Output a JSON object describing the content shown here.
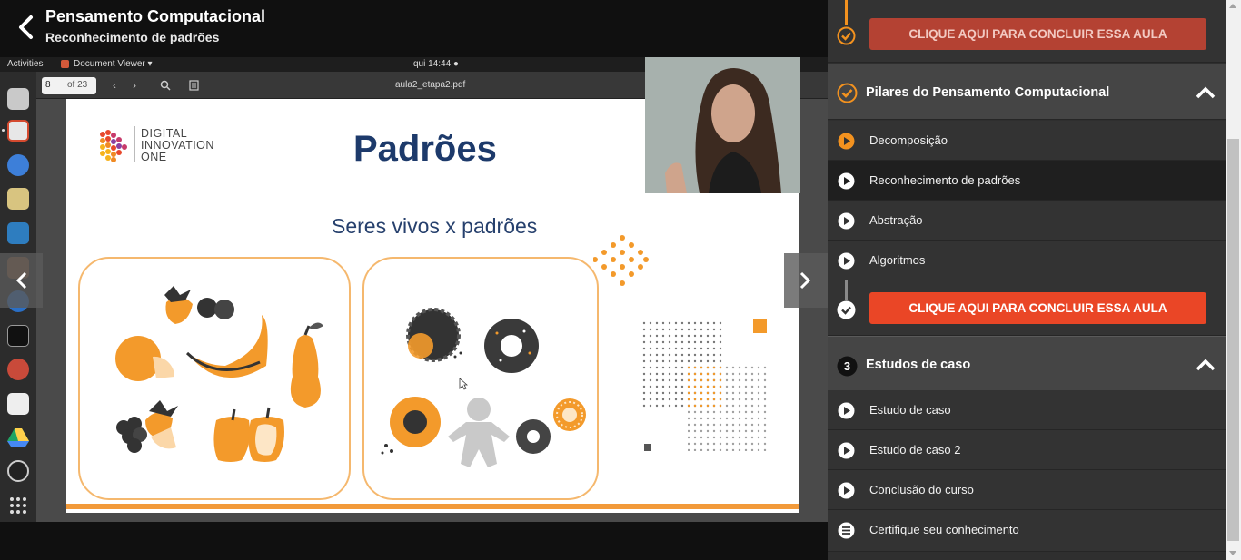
{
  "header": {
    "title": "Pensamento Computacional",
    "subtitle": "Reconhecimento de padrões"
  },
  "video": {
    "system_bar": {
      "activities": "Activities",
      "app_name": "Document Viewer ▾",
      "clock": "qui 14:44 ●"
    },
    "viewer": {
      "page_number": "8",
      "page_total": "of 23",
      "filename": "aula2_etapa2.pdf"
    },
    "slide": {
      "logo_line1": "DIGITAL",
      "logo_line2": "INNOVATION",
      "logo_line3": "ONE",
      "title": "Padrões",
      "subtitle": "Seres vivos x padrões"
    }
  },
  "sidebar": {
    "top_complete_label": "CLIQUE AQUI PARA CONCLUIR ESSA AULA",
    "section_pilares": {
      "title": "Pilares do Pensamento Computacional",
      "lessons": [
        {
          "label": "Decomposição"
        },
        {
          "label": "Reconhecimento de padrões"
        },
        {
          "label": "Abstração"
        },
        {
          "label": "Algoritmos"
        }
      ],
      "complete_label": "CLIQUE AQUI PARA CONCLUIR ESSA AULA"
    },
    "section_estudos": {
      "number": "3",
      "title": "Estudos de caso",
      "lessons": [
        {
          "label": "Estudo de caso"
        },
        {
          "label": "Estudo de caso 2"
        },
        {
          "label": "Conclusão do curso"
        },
        {
          "label": "Certifique seu conhecimento"
        }
      ]
    }
  },
  "colors": {
    "accent_orange": "#f3921f",
    "complete_button": "#ea4626",
    "slide_title_blue": "#1d3a6b"
  }
}
